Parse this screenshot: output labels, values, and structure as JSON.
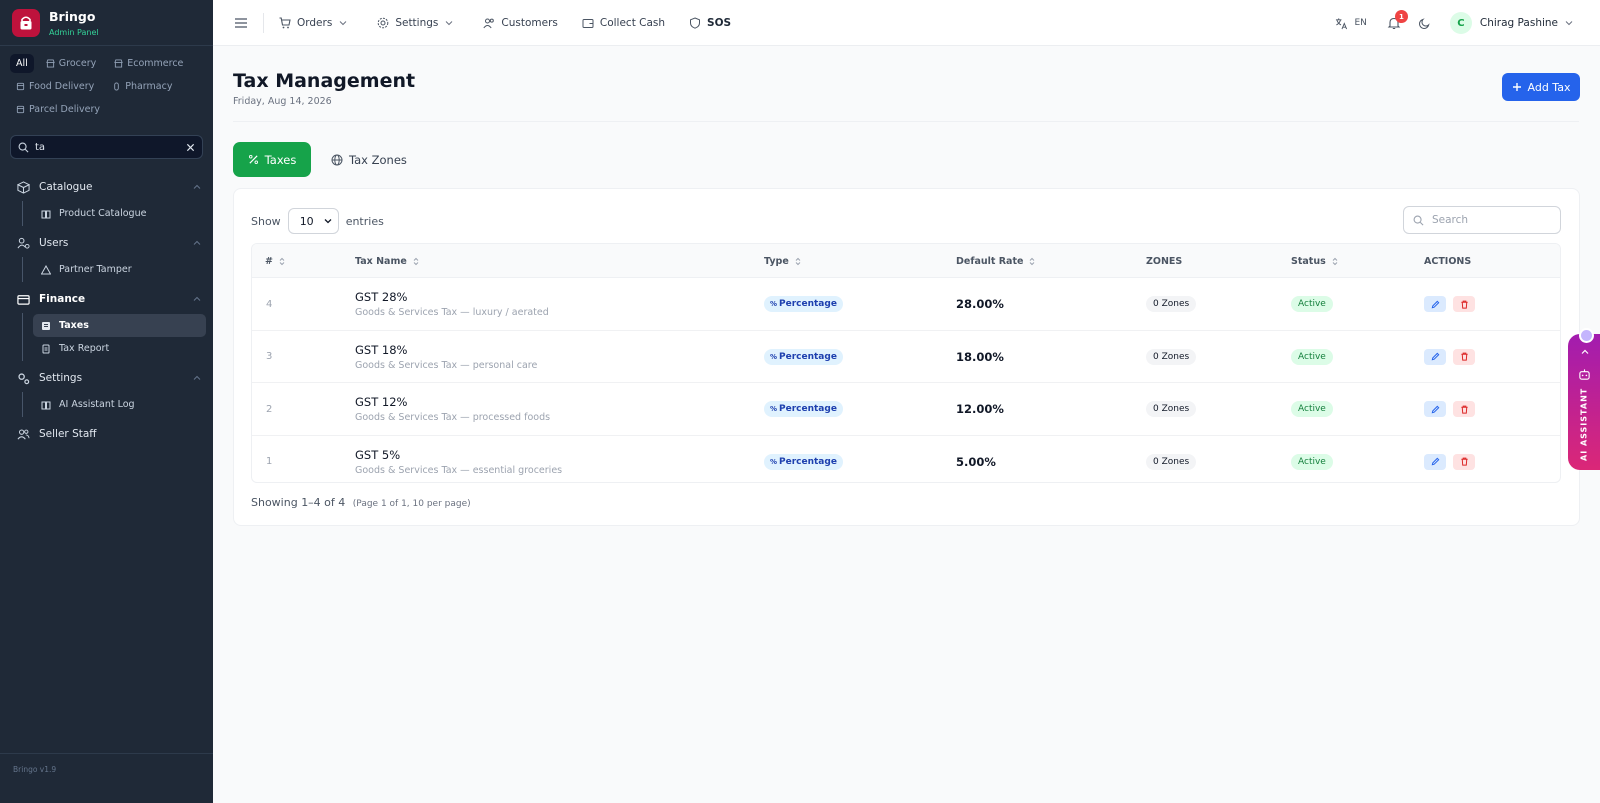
{
  "app": {
    "name": "Bringo",
    "subtitle": "Admin Panel",
    "version": "Bringo v1.9"
  },
  "sidebar": {
    "modules": [
      {
        "label": "All",
        "active": true
      },
      {
        "label": "Grocery"
      },
      {
        "label": "Ecommerce"
      },
      {
        "label": "Food Delivery"
      },
      {
        "label": "Pharmacy"
      },
      {
        "label": "Parcel Delivery"
      }
    ],
    "search_value": "ta",
    "sections": [
      {
        "label": "Catalogue",
        "items": [
          {
            "label": "Product Catalogue"
          }
        ]
      },
      {
        "label": "Users",
        "items": [
          {
            "label": "Partner Tamper"
          }
        ]
      },
      {
        "label": "Finance",
        "items": [
          {
            "label": "Taxes",
            "active": true
          },
          {
            "label": "Tax Report"
          }
        ]
      },
      {
        "label": "Settings",
        "items": [
          {
            "label": "AI Assistant Log"
          }
        ]
      }
    ],
    "seller_staff": "Seller Staff"
  },
  "topnav": {
    "items": [
      {
        "label": "Orders"
      },
      {
        "label": "Settings"
      },
      {
        "label": "Customers"
      },
      {
        "label": "Collect Cash"
      },
      {
        "label": "SOS"
      }
    ],
    "lang": "EN",
    "notification_count": "1",
    "user": {
      "initial": "C",
      "name": "Chirag Pashine"
    }
  },
  "page": {
    "title": "Tax Management",
    "date": "Friday, Aug 14, 2026",
    "add_button": "Add Tax",
    "tabs": [
      {
        "label": "Taxes",
        "active": true
      },
      {
        "label": "Tax Zones"
      }
    ]
  },
  "table": {
    "show_label": "Show",
    "entries_label": "entries",
    "page_size": "10",
    "search_placeholder": "Search",
    "columns": [
      "#",
      "Tax Name",
      "Type",
      "Default Rate",
      "ZONES",
      "Status",
      "ACTIONS"
    ],
    "rows": [
      {
        "id": "4",
        "name": "GST 28%",
        "desc": "Goods & Services Tax — luxury / aerated",
        "type": "Percentage",
        "rate": "28.00%",
        "zones": "0 Zones",
        "status": "Active"
      },
      {
        "id": "3",
        "name": "GST 18%",
        "desc": "Goods & Services Tax — personal care",
        "type": "Percentage",
        "rate": "18.00%",
        "zones": "0 Zones",
        "status": "Active"
      },
      {
        "id": "2",
        "name": "GST 12%",
        "desc": "Goods & Services Tax — processed foods",
        "type": "Percentage",
        "rate": "12.00%",
        "zones": "0 Zones",
        "status": "Active"
      },
      {
        "id": "1",
        "name": "GST 5%",
        "desc": "Goods & Services Tax — essential groceries",
        "type": "Percentage",
        "rate": "5.00%",
        "zones": "0 Zones",
        "status": "Active"
      }
    ],
    "summary": "Showing 1–4 of 4",
    "summary_sub": "(Page 1 of 1, 10 per page)"
  },
  "ai_assistant": {
    "label": "AI ASSISTANT"
  },
  "colors": {
    "sidebar_bg": "#1f2937",
    "primary": "#2563eb",
    "success": "#16a34a",
    "brand": "#be123c",
    "ai": "#c026d3"
  }
}
